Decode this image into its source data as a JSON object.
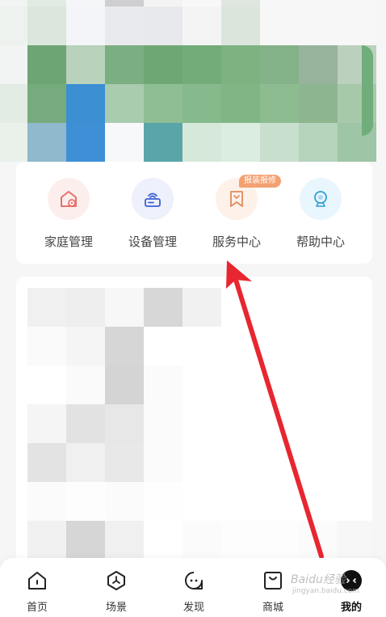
{
  "quick_actions": {
    "items": [
      {
        "label": "家庭管理",
        "icon": "home-settings-icon",
        "tint": "#fdeeee"
      },
      {
        "label": "设备管理",
        "icon": "router-icon",
        "tint": "#eef0fb"
      },
      {
        "label": "服务中心",
        "icon": "service-bookmark-icon",
        "tint": "#fdf1ea"
      },
      {
        "label": "帮助中心",
        "icon": "help-camera-icon",
        "tint": "#e9f6fd"
      }
    ],
    "service_badge": "报装报修"
  },
  "tabbar": {
    "tabs": [
      {
        "label": "首页",
        "icon": "home-icon",
        "active": false
      },
      {
        "label": "场景",
        "icon": "scene-icon",
        "active": false
      },
      {
        "label": "发现",
        "icon": "discover-icon",
        "active": false
      },
      {
        "label": "商城",
        "icon": "store-icon",
        "active": false
      },
      {
        "label": "我的",
        "icon": "profile-icon",
        "active": true
      }
    ]
  },
  "watermark": {
    "logo_text": "Baidu经验",
    "sub_text": "jingyan.baidu.com"
  },
  "colors": {
    "accent_arrow": "#e8262f",
    "badge": "#f4a172",
    "icon_red": "#e9706a",
    "icon_blue": "#3a5fd6",
    "icon_orange": "#e08a5a",
    "icon_cyan": "#2f9ed6"
  }
}
